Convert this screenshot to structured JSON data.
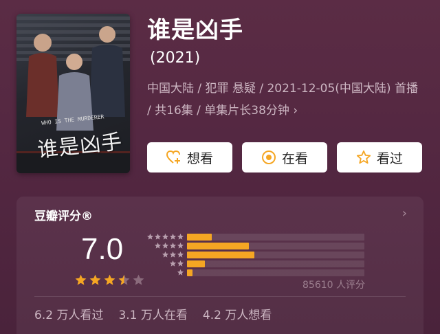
{
  "movie": {
    "title": "谁是凶手",
    "year": "(2021)",
    "meta": "中国大陆 / 犯罪 悬疑 / 2021-12-05(中国大陆) 首播 / 共16集 / 单集片长38分钟",
    "meta_chevron": "›",
    "poster_title": "谁是凶手",
    "poster_en": "WHO IS THE MURDERER"
  },
  "actions": {
    "want": "想看",
    "watching": "在看",
    "watched": "看过"
  },
  "rating": {
    "header": "豆瓣评分®",
    "score": "7.0",
    "stars_filled": 3.5,
    "distribution": [
      {
        "stars": 5,
        "percent": 14
      },
      {
        "stars": 4,
        "percent": 35
      },
      {
        "stars": 3,
        "percent": 38
      },
      {
        "stars": 2,
        "percent": 10
      },
      {
        "stars": 1,
        "percent": 3
      }
    ],
    "count": "85610 人评分",
    "stats": [
      "6.2 万人看过",
      "3.1 万人在看",
      "4.2 万人想看"
    ]
  },
  "colors": {
    "accent": "#f5a623",
    "star_empty": "#8a6b7c",
    "button_icon": "#f5a623"
  }
}
